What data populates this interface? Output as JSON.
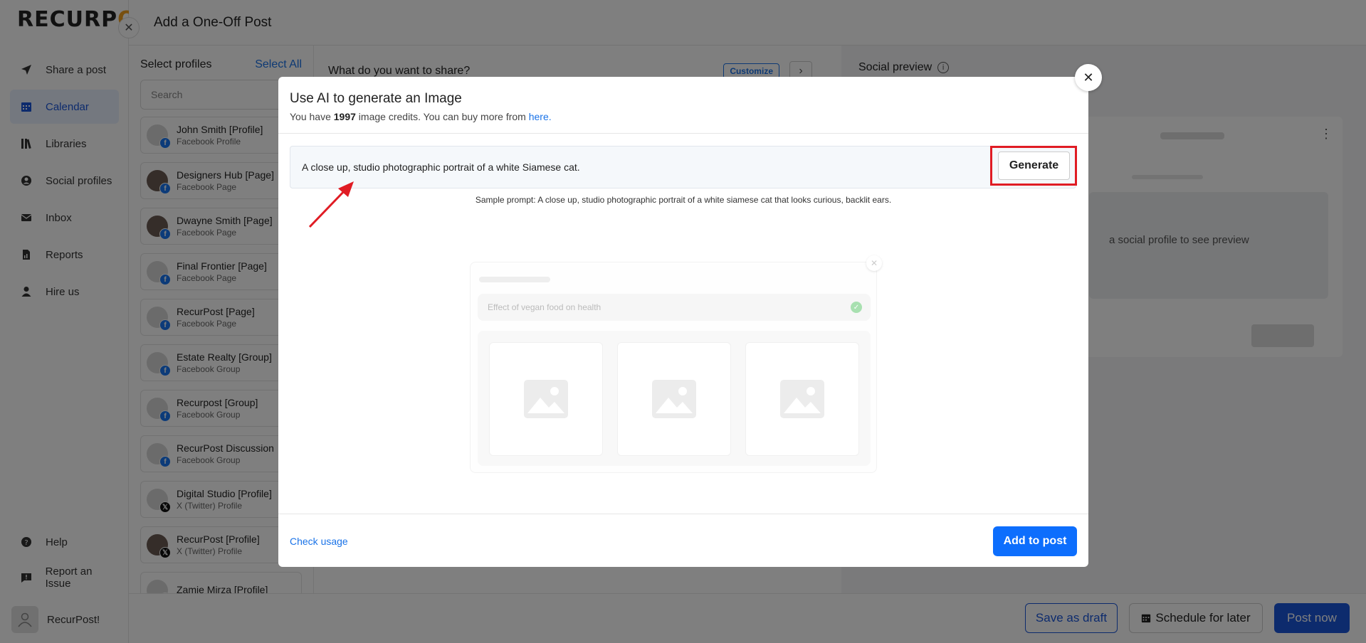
{
  "app": {
    "logo_main": "RECURP",
    "logo_tail": "O",
    "nav": [
      {
        "label": "Share a post",
        "icon": "send-icon"
      },
      {
        "label": "Calendar",
        "icon": "calendar-icon",
        "active": true
      },
      {
        "label": "Libraries",
        "icon": "library-icon"
      },
      {
        "label": "Social profiles",
        "icon": "user-circle-icon"
      },
      {
        "label": "Inbox",
        "icon": "inbox-icon"
      },
      {
        "label": "Reports",
        "icon": "report-icon"
      },
      {
        "label": "Hire us",
        "icon": "person-icon"
      }
    ],
    "nav_bottom": [
      {
        "label": "Help",
        "icon": "help-icon"
      },
      {
        "label": "Report an Issue",
        "icon": "report-issue-icon"
      }
    ],
    "user_name": "RecurPost!"
  },
  "compose": {
    "title": "Add a One-Off Post",
    "select_profiles_label": "Select profiles",
    "select_all_label": "Select All",
    "search_placeholder": "Search",
    "profiles": [
      {
        "name": "John Smith [Profile]",
        "type": "Facebook Profile",
        "network": "facebook"
      },
      {
        "name": "Designers Hub [Page]",
        "type": "Facebook Page",
        "network": "facebook"
      },
      {
        "name": "Dwayne Smith [Page]",
        "type": "Facebook Page",
        "network": "facebook"
      },
      {
        "name": "Final Frontier [Page]",
        "type": "Facebook Page",
        "network": "facebook"
      },
      {
        "name": "RecurPost [Page]",
        "type": "Facebook Page",
        "network": "facebook"
      },
      {
        "name": "Estate Realty [Group]",
        "type": "Facebook Group",
        "network": "facebook"
      },
      {
        "name": "Recurpost [Group]",
        "type": "Facebook Group",
        "network": "facebook"
      },
      {
        "name": "RecurPost Discussion",
        "type": "Facebook Group",
        "network": "facebook"
      },
      {
        "name": "Digital Studio [Profile]",
        "type": "X (Twitter) Profile",
        "network": "x"
      },
      {
        "name": "RecurPost [Profile]",
        "type": "X (Twitter) Profile",
        "network": "x"
      },
      {
        "name": "Zamie Mirza [Profile]",
        "type": "",
        "network": "x"
      }
    ],
    "share_question": "What do you want to share?",
    "customize_label": "Customize",
    "social_preview_label": "Social preview",
    "preview_hint": "a social profile to see preview",
    "save_draft_label": "Save as draft",
    "schedule_label": "Schedule for later",
    "post_now_label": "Post now"
  },
  "modal": {
    "title": "Use AI to generate an Image",
    "sub_prefix": "You have ",
    "credits": "1997",
    "sub_middle": " image credits. You can buy more from ",
    "sub_link": "here.",
    "prompt_value": "A close up, studio photographic portrait of a white Siamese cat.",
    "generate_label": "Generate",
    "sample_prompt": "Sample prompt: A close up, studio photographic portrait of a white siamese cat that looks curious, backlit ears.",
    "placeholder_input": "Effect of vegan food on health",
    "check_usage_label": "Check usage",
    "add_to_post_label": "Add to post"
  },
  "colors": {
    "brand_blue": "#1a56db",
    "link_blue": "#1a73e8",
    "primary_button": "#0d6efd",
    "highlight_red": "#e01c24"
  }
}
